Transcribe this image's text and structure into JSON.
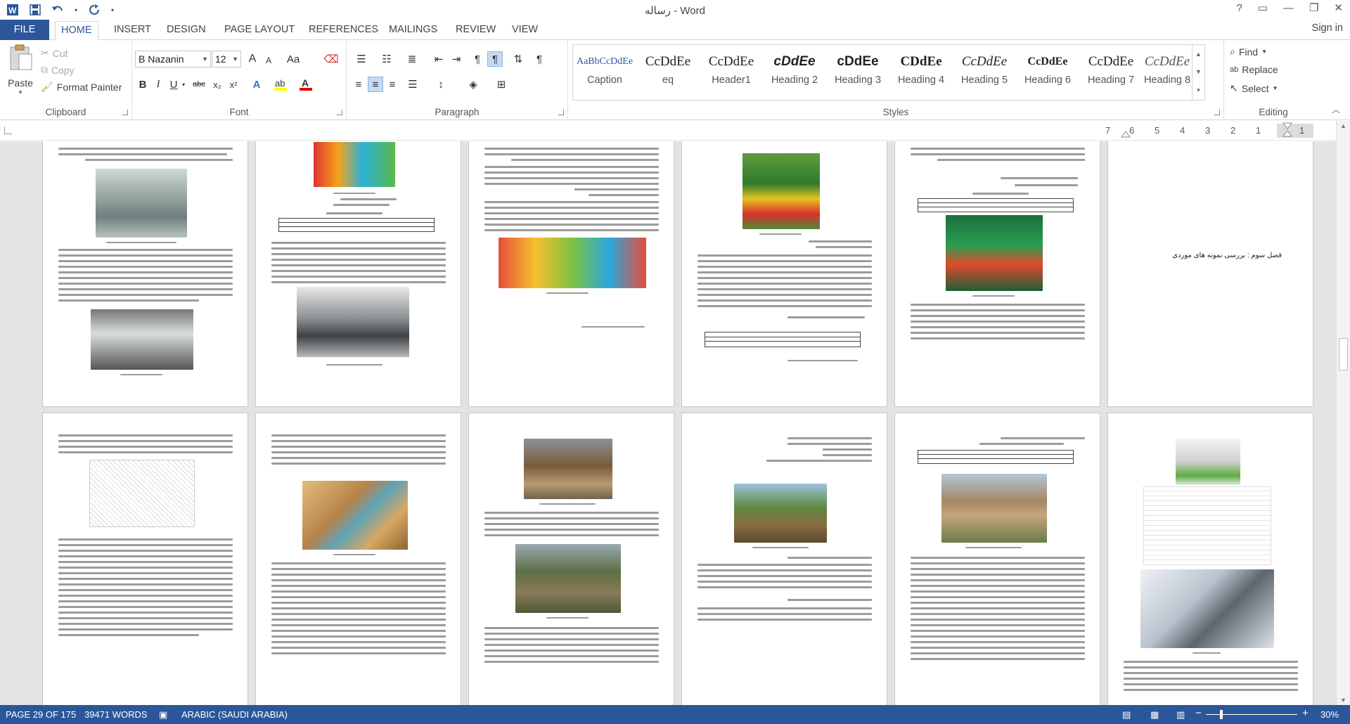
{
  "app": {
    "title": "رساله - Word",
    "sign_in": "Sign in"
  },
  "window_controls": {
    "help": "?",
    "restore_ribbon": "▭",
    "minimize": "—",
    "maximize": "❐",
    "close": "✕"
  },
  "tabs": [
    "FILE",
    "HOME",
    "INSERT",
    "DESIGN",
    "PAGE LAYOUT",
    "REFERENCES",
    "MAILINGS",
    "REVIEW",
    "VIEW"
  ],
  "active_tab": "HOME",
  "clipboard": {
    "paste": "Paste",
    "cut": "Cut",
    "copy": "Copy",
    "format_painter": "Format Painter",
    "label": "Clipboard"
  },
  "font": {
    "name": "B Nazanin",
    "size": "12",
    "label": "Font",
    "grow": "A",
    "shrink": "A",
    "change_case": "Aa",
    "bold": "B",
    "italic": "I",
    "underline": "U",
    "strike": "abc",
    "subscript": "x₂",
    "superscript": "x²"
  },
  "paragraph": {
    "label": "Paragraph"
  },
  "styles": {
    "label": "Styles",
    "items": [
      {
        "sample": "AaBbCcDdEe",
        "name": "Caption"
      },
      {
        "sample": "CcDdEe",
        "name": "eq"
      },
      {
        "sample": "CcDdEe",
        "name": "Header1"
      },
      {
        "sample": "cDdEe",
        "name": "Heading 2"
      },
      {
        "sample": "cDdEe",
        "name": "Heading 3"
      },
      {
        "sample": "CDdEe",
        "name": "Heading 4"
      },
      {
        "sample": "CcDdEe",
        "name": "Heading 5"
      },
      {
        "sample": "CcDdEe",
        "name": "Heading 6"
      },
      {
        "sample": "CcDdEe",
        "name": "Heading 7"
      },
      {
        "sample": "CcDdEe",
        "name": "Heading 8"
      }
    ]
  },
  "editing": {
    "label": "Editing",
    "find": "Find",
    "replace": "Replace",
    "select": "Select"
  },
  "ruler": {
    "numbers": [
      "7",
      "6",
      "5",
      "4",
      "3",
      "2",
      "1",
      "1"
    ]
  },
  "document": {
    "heading_page_text": "فصل سوم : بررسی نمونه های موردی"
  },
  "status": {
    "page": "PAGE 29 OF 175",
    "words": "39471 WORDS",
    "language": "ARABIC (SAUDI ARABIA)",
    "zoom": "30%"
  },
  "colors": {
    "accent": "#2b579a",
    "active_tab_text": "#2b579a",
    "font_color_bar": "#e00000",
    "highlight_bar": "#ffff00"
  }
}
